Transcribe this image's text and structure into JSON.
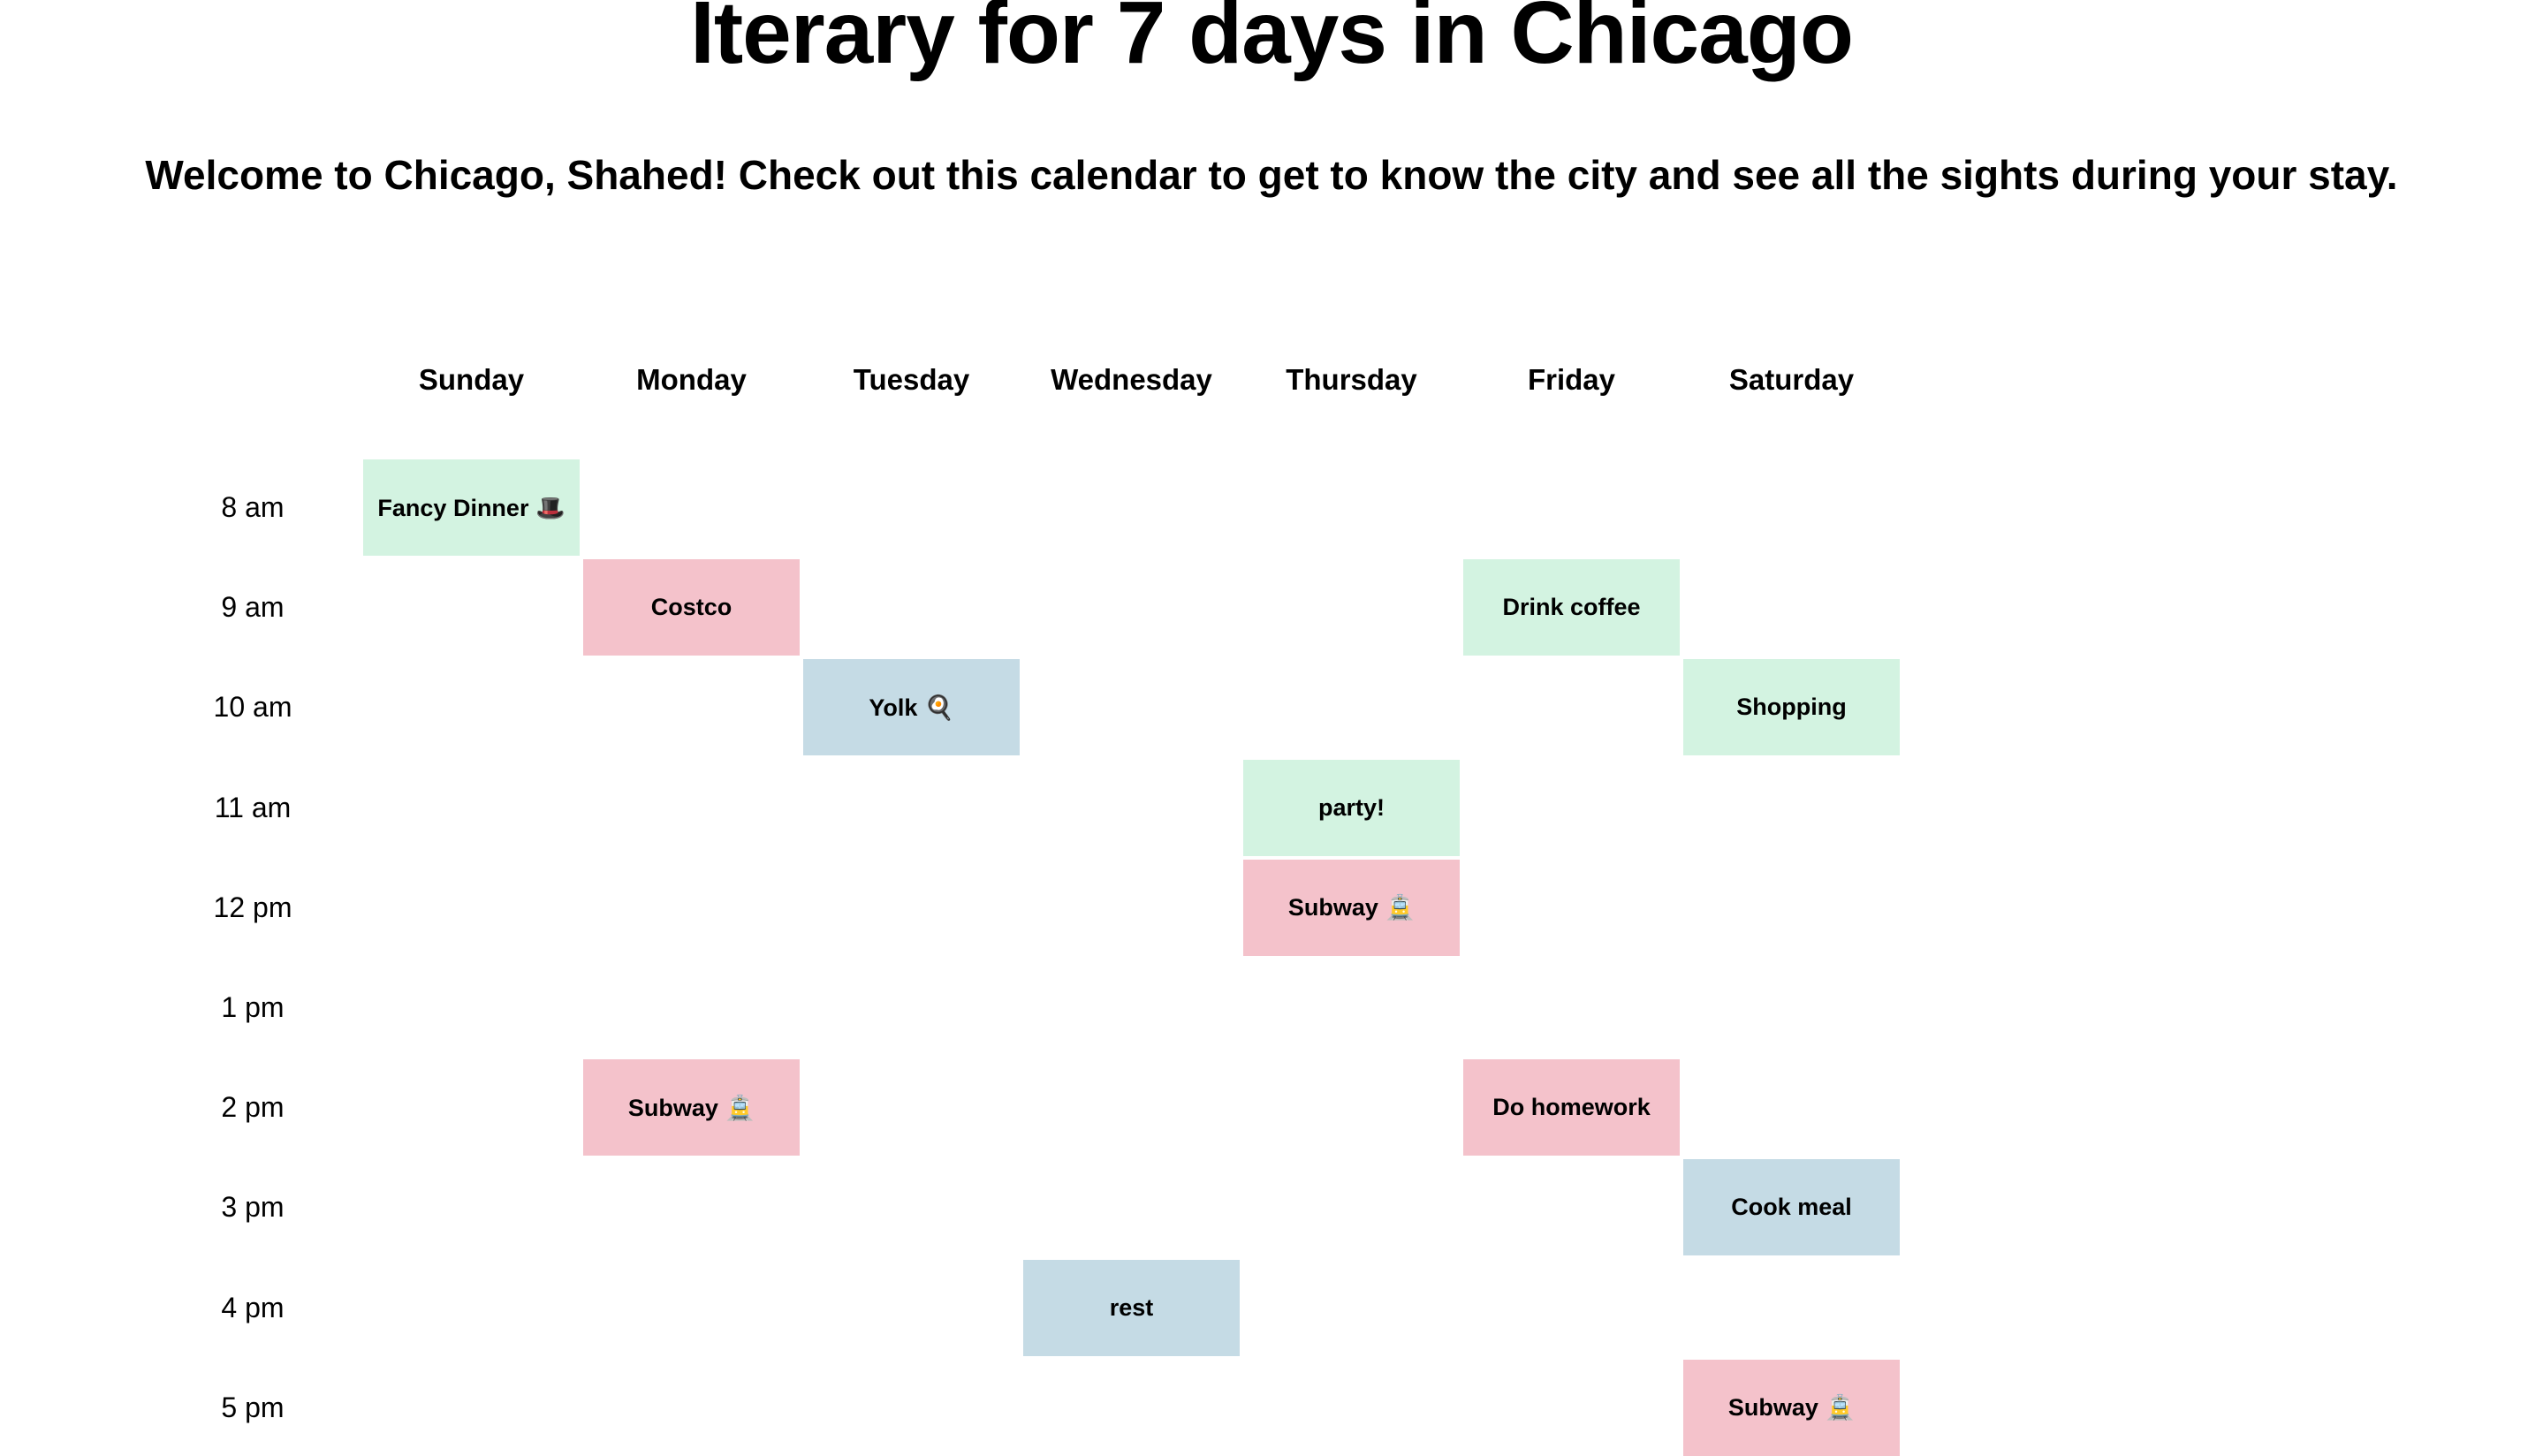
{
  "header": {
    "title": "Iterary for 7 days in Chicago",
    "subtitle": "Welcome to Chicago, Shahed! Check out this calendar to get to know the city and see all the sights during your stay."
  },
  "colors": {
    "green": "#d3f3e1",
    "pink": "#f4c2cb",
    "blue": "#c5dbe5"
  },
  "days": [
    "Sunday",
    "Monday",
    "Tuesday",
    "Wednesday",
    "Thursday",
    "Friday",
    "Saturday"
  ],
  "times": [
    "8 am",
    "9 am",
    "10 am",
    "11 am",
    "12 pm",
    "1 pm",
    "2 pm",
    "3 pm",
    "4 pm",
    "5 pm"
  ],
  "events": [
    {
      "label": "Fancy Dinner 🎩",
      "day": "Sunday",
      "time": "8 am",
      "color": "green"
    },
    {
      "label": "Costco",
      "day": "Monday",
      "time": "9 am",
      "color": "pink"
    },
    {
      "label": "Drink coffee",
      "day": "Friday",
      "time": "9 am",
      "color": "green"
    },
    {
      "label": "Yolk 🍳",
      "day": "Tuesday",
      "time": "10 am",
      "color": "blue"
    },
    {
      "label": "Shopping",
      "day": "Saturday",
      "time": "10 am",
      "color": "green"
    },
    {
      "label": "party!",
      "day": "Thursday",
      "time": "11 am",
      "color": "green"
    },
    {
      "label": "Subway 🚊",
      "day": "Thursday",
      "time": "12 pm",
      "color": "pink"
    },
    {
      "label": "Subway 🚊",
      "day": "Monday",
      "time": "2 pm",
      "color": "pink"
    },
    {
      "label": "Do homework",
      "day": "Friday",
      "time": "2 pm",
      "color": "pink"
    },
    {
      "label": "Cook meal",
      "day": "Saturday",
      "time": "3 pm",
      "color": "blue"
    },
    {
      "label": "rest",
      "day": "Wednesday",
      "time": "4 pm",
      "color": "blue"
    },
    {
      "label": "Subway 🚊",
      "day": "Saturday",
      "time": "5 pm",
      "color": "pink"
    }
  ]
}
